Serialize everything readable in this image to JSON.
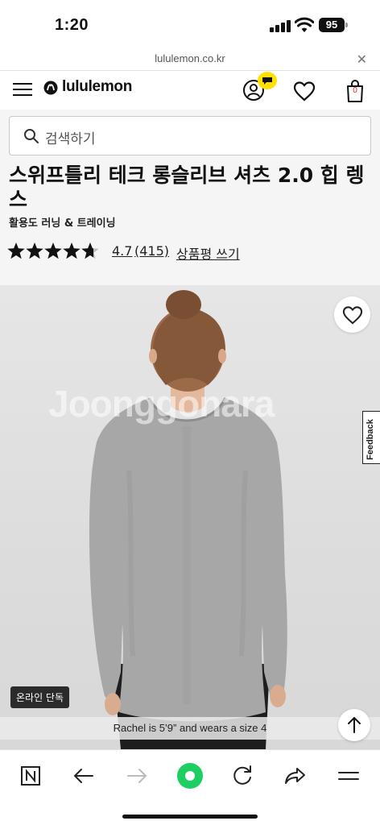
{
  "status_bar": {
    "time": "1:20",
    "battery": "95"
  },
  "browser": {
    "url": "lululemon.co.kr"
  },
  "header": {
    "brand": "lululemon",
    "bag_count": "0"
  },
  "search": {
    "placeholder": "검색하기"
  },
  "product": {
    "title": "스위프틀리 테크 롱슬리브 셔츠 2.0 힙 렝스",
    "category": "활용도 러닝 & 트레이닝",
    "rating": "4.7",
    "review_count": "(415)",
    "write_review": "상품평 쓰기",
    "stars_filled": 4.7,
    "stars_total": 5
  },
  "image": {
    "watermark": "Joonggonara",
    "feedback_label": "Feedback",
    "badge": "온라인 단독",
    "caption": "Rachel is 5’9” and wears a size 4"
  },
  "colors": {
    "yellow_badge": "#ffe000",
    "badge_bg": "#2b2b2b",
    "search_bg": "#f5f5f5"
  },
  "toolbar": {
    "items": [
      "naver-home-icon",
      "back-icon",
      "forward-icon",
      "green-circle-icon",
      "refresh-icon",
      "share-icon",
      "menu-icon"
    ]
  }
}
